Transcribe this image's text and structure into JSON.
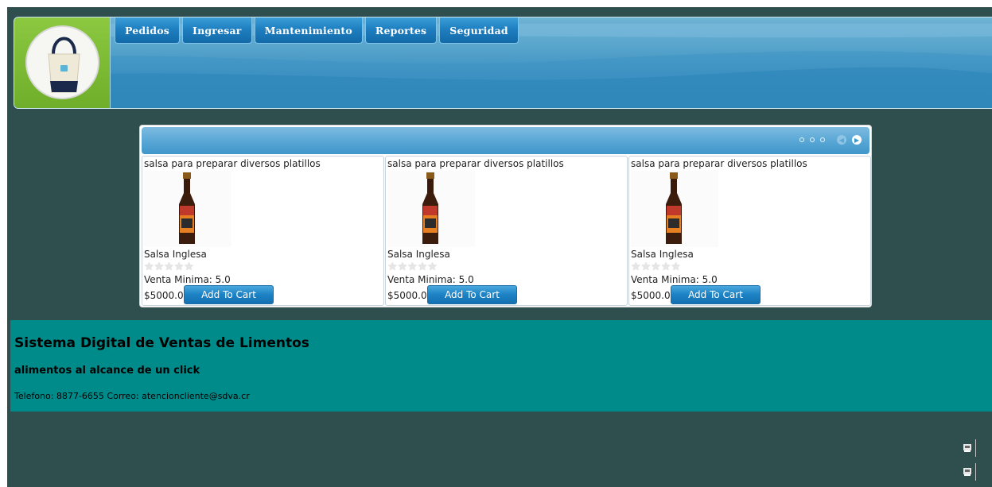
{
  "nav": {
    "items": [
      {
        "label": "Pedidos"
      },
      {
        "label": "Ingresar"
      },
      {
        "label": "Mantenimiento"
      },
      {
        "label": "Reportes"
      },
      {
        "label": "Seguridad"
      }
    ]
  },
  "logo": {
    "icon": "tote-bag-icon"
  },
  "carousel": {
    "pager": {
      "dots": 3,
      "prev_icon": "chevron-left-icon",
      "next_icon": "chevron-right-icon"
    },
    "products": [
      {
        "description": "salsa para preparar diversos platillos",
        "name": "Salsa Inglesa",
        "rating": 0,
        "minimum": "Venta Minima: 5.0",
        "price": "$5000.0",
        "button": "Add To Cart",
        "image_icon": "sauce-bottle-icon"
      },
      {
        "description": "salsa para preparar diversos platillos",
        "name": "Salsa Inglesa",
        "rating": 0,
        "minimum": "Venta Minima: 5.0",
        "price": "$5000.0",
        "button": "Add To Cart",
        "image_icon": "sauce-bottle-icon"
      },
      {
        "description": "salsa para preparar diversos platillos",
        "name": "Salsa Inglesa",
        "rating": 0,
        "minimum": "Venta Minima: 5.0",
        "price": "$5000.0",
        "button": "Add To Cart",
        "image_icon": "sauce-bottle-icon"
      }
    ]
  },
  "footer": {
    "title": "Sistema Digital de Ventas de Limentos",
    "subtitle": "alimentos al alcance de un click",
    "contact": "Telefono: 8877-6655 Correo: atencioncliente@sdva.cr"
  },
  "side_icons": [
    "app-icon",
    "app-icon"
  ],
  "colors": {
    "page_bg": "#2f4f4f",
    "footer_bg": "#008b8b",
    "nav_bg": "#1f7fc0",
    "logo_bg": "#6fae2a"
  }
}
